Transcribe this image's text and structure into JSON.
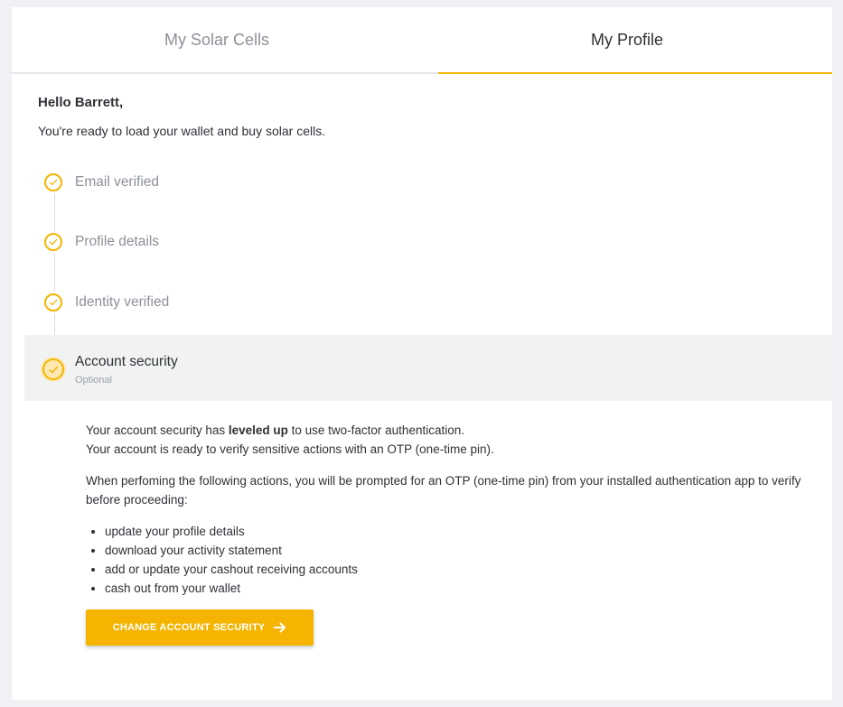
{
  "tabs": [
    {
      "label": "My Solar Cells",
      "active": false
    },
    {
      "label": "My Profile",
      "active": true
    }
  ],
  "greeting": "Hello Barrett,",
  "subtitle": "You're ready to load your wallet and buy solar cells.",
  "steps": [
    {
      "label": "Email verified",
      "status": "complete"
    },
    {
      "label": "Profile details",
      "status": "complete"
    },
    {
      "label": "Identity verified",
      "status": "complete"
    },
    {
      "label": "Account security",
      "sublabel": "Optional",
      "status": "complete"
    }
  ],
  "security": {
    "line1_prefix": "Your account security has ",
    "line1_bold": "leveled up",
    "line1_suffix": " to use two-factor authentication.",
    "line2": "Your account is ready to verify sensitive actions with an OTP (one-time pin).",
    "prompt_text": "When perfoming the following actions, you will be prompted for an OTP (one-time pin) from your installed authentication app to verify before proceeding:",
    "actions": [
      "update your profile details",
      "download your activity statement",
      "add or update your cashout receiving accounts",
      "cash out from your wallet"
    ],
    "button_label": "CHANGE ACCOUNT SECURITY"
  },
  "colors": {
    "accent": "#f4b400",
    "active_step_bg": "#f1f2f2",
    "muted_text": "#8c9098"
  },
  "icons": {
    "step": "check-circle-icon",
    "button": "arrow-right-icon"
  }
}
